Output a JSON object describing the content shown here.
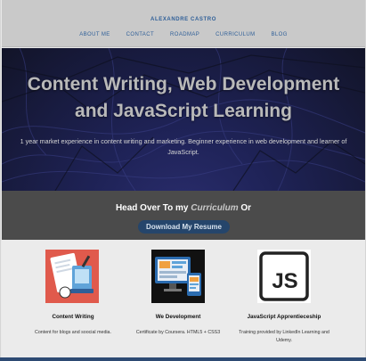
{
  "header": {
    "brand": "ALEXANDRE CASTRO",
    "nav": [
      "ABOUT ME",
      "CONTACT",
      "ROADMAP",
      "CURRICULUM",
      "BLOG"
    ]
  },
  "hero": {
    "title_line1": "Content Writing, Web Development",
    "title_line2": "and JavaScript Learning",
    "subtitle": "1 year market experience in content writing and marketing. Beginner experience in web development and learner of JavaScript."
  },
  "cta": {
    "text_before": "Head Over To my ",
    "text_em": "Curriculum",
    "text_after": " Or",
    "button_label": "Download My Resume"
  },
  "features": [
    {
      "title": "Content Writing",
      "desc": "Content for blogs and soocial media."
    },
    {
      "title": "We Development",
      "desc": "Certificate by Coursera. HTML5 + CSS3"
    },
    {
      "title": "JavaScript Apprentieceship",
      "desc": "Training provided by LinkedIn Learning and Udemy."
    }
  ],
  "icons": {
    "js_label": "JS"
  },
  "colors": {
    "header_bg": "#c9c9c9",
    "brand_blue": "#2f5f98",
    "cta_bg": "#4b4b4b",
    "button_bg": "#25456b",
    "feature_writing_bg": "#e05a4c",
    "bottom_bar": "#2d4a73"
  }
}
